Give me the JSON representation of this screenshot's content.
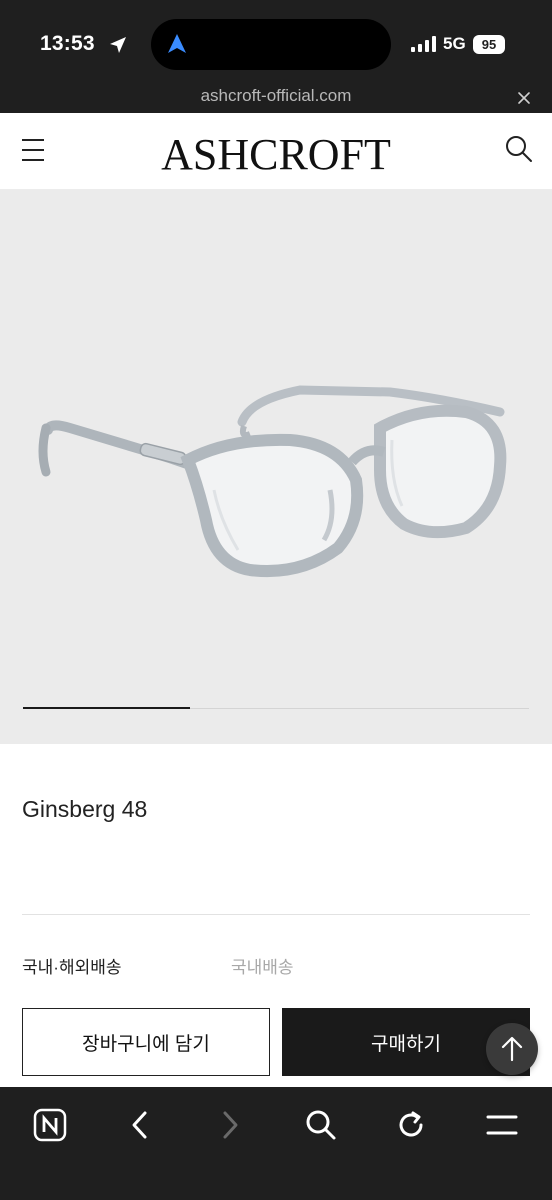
{
  "status_bar": {
    "time": "13:53",
    "network": "5G",
    "battery": "95"
  },
  "browser": {
    "url": "ashcroft-official.com"
  },
  "header": {
    "logo": "ASHCROFT"
  },
  "gallery": {
    "image_description_icon": "glasses-photo",
    "slide_progress": 0.33
  },
  "product": {
    "name": "Ginsberg 48",
    "shipping_label": "국내·해외배송",
    "shipping_value": "국내배송"
  },
  "actions": {
    "cart_label": "장바구니에 담기",
    "buy_label": "구매하기"
  },
  "colors": {
    "dark_chrome": "#1f1f1f",
    "gallery_bg": "#ebebeb",
    "buy_button": "#1a1a1a"
  },
  "toolbar": {
    "icons": [
      "naver-n-icon",
      "back-icon",
      "forward-icon",
      "search-icon",
      "refresh-icon",
      "menu-icon"
    ]
  }
}
